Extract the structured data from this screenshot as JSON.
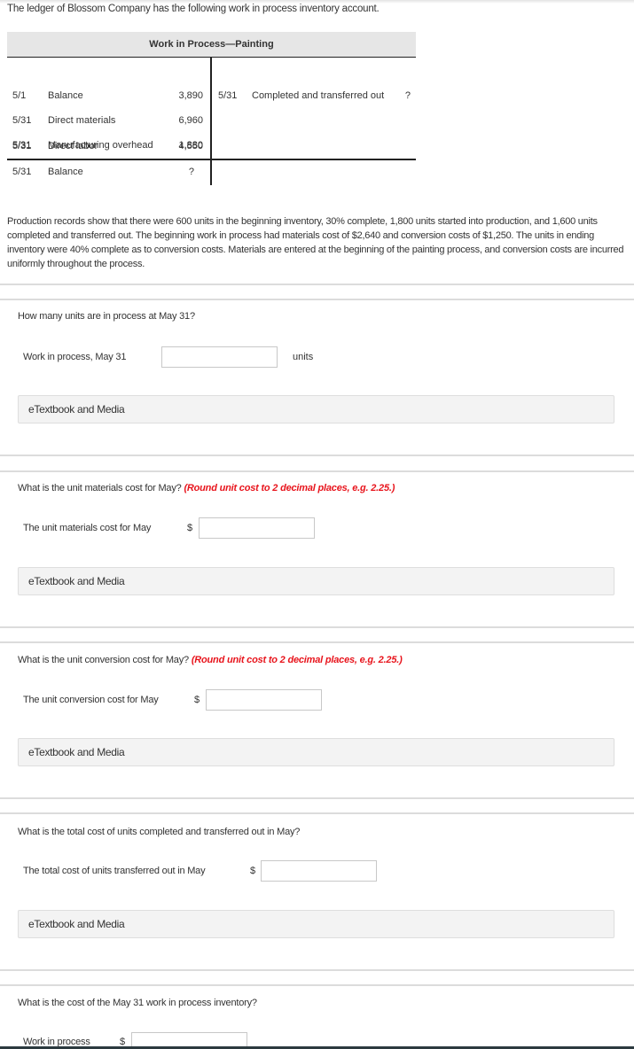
{
  "intro": "The ledger of Blossom Company has the following work in process inventory account.",
  "t_account": {
    "title": "Work in Process—Painting",
    "debits": [
      {
        "date": "5/1",
        "description": "Balance",
        "amount": "3,890"
      },
      {
        "date": "5/31",
        "description": "Direct materials",
        "amount": "6,960"
      },
      {
        "date": "5/31",
        "description": "Direct labor",
        "amount": "4,550"
      },
      {
        "date": "5/31",
        "description": "Manufacturing overhead",
        "amount": "1,880"
      }
    ],
    "credits": [
      {
        "date": "5/31",
        "description": "Completed and transferred out",
        "amount": "?"
      }
    ],
    "ending_balance": {
      "date": "5/31",
      "description": "Balance",
      "amount": "?"
    }
  },
  "production_info": "Production records show that there were 600 units in the beginning inventory, 30% complete, 1,800 units started into production, and 1,600 units completed and transferred out. The beginning work in process had materials cost of $2,640 and conversion costs of $1,250. The units in ending inventory were 40% complete as to conversion costs. Materials are entered at the beginning of the painting process, and conversion costs are incurred uniformly throughout the process.",
  "questions": [
    {
      "question": "How many units are in process at May 31?",
      "hint": "",
      "answer_label": "Work in process, May 31",
      "prefix": "",
      "suffix": "units",
      "value": "",
      "etextbook_label": "eTextbook and Media"
    },
    {
      "question": "What is the unit materials cost for May?",
      "hint": "(Round unit cost to 2 decimal places, e.g. 2.25.)",
      "answer_label": "The unit materials cost for May",
      "prefix": "$",
      "suffix": "",
      "value": "",
      "etextbook_label": "eTextbook and Media"
    },
    {
      "question": "What is the unit conversion cost for May?",
      "hint": "(Round unit cost to 2 decimal places, e.g. 2.25.)",
      "answer_label": "The unit conversion cost for May",
      "prefix": "$",
      "suffix": "",
      "value": "",
      "etextbook_label": "eTextbook and Media"
    },
    {
      "question": "What is the total cost of units completed and transferred out in May?",
      "hint": "",
      "answer_label": "The total cost of units transferred out in May",
      "prefix": "$",
      "suffix": "",
      "value": "",
      "etextbook_label": "eTextbook and Media"
    },
    {
      "question": "What is the cost of the May 31 work in process inventory?",
      "hint": "",
      "answer_label": "Work in process",
      "prefix": "$",
      "suffix": "",
      "value": ""
    }
  ],
  "colors": {
    "hint_red": "#e8141c",
    "header_gray": "#e6e6e6",
    "etextbook_bg": "#f3f3f3"
  }
}
